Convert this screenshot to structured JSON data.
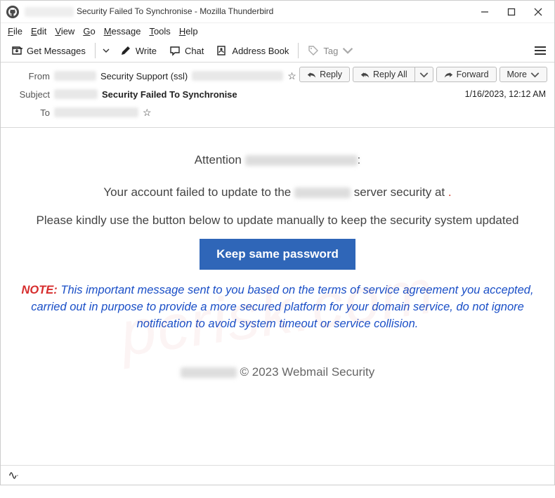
{
  "titlebar": {
    "title_suffix": "Security Failed To Synchronise - Mozilla Thunderbird"
  },
  "menubar": {
    "file": "File",
    "edit": "Edit",
    "view": "View",
    "go": "Go",
    "message": "Message",
    "tools": "Tools",
    "help": "Help"
  },
  "toolbar": {
    "get_messages": "Get Messages",
    "write": "Write",
    "chat": "Chat",
    "address_book": "Address Book",
    "tag": "Tag"
  },
  "header": {
    "from_label": "From",
    "subject_label": "Subject",
    "to_label": "To",
    "from_name": "Security Support (ssl)",
    "subject_text": "Security Failed To Synchronise",
    "timestamp": "1/16/2023, 12:12 AM"
  },
  "actions": {
    "reply": "Reply",
    "reply_all": "Reply All",
    "forward": "Forward",
    "more": "More"
  },
  "body": {
    "attention_prefix": "Attention ",
    "attention_suffix": ":",
    "line2a": "Your account failed to update to the ",
    "line2b": " server security at ",
    "line2c": ".",
    "line3": "Please kindly use the button below to update manually to keep the security system updated",
    "button": "Keep same password",
    "note_label": "NOTE:",
    "note_text": "    This important message sent to you based on the terms of service agreement you accepted, carried out in  purpose to provide a more secured platform for your domain service, do not ignore notification to avoid system timeout or service collision.",
    "footer_suffix": " © 2023 Webmail Security"
  },
  "watermark": "pcrisk.com"
}
